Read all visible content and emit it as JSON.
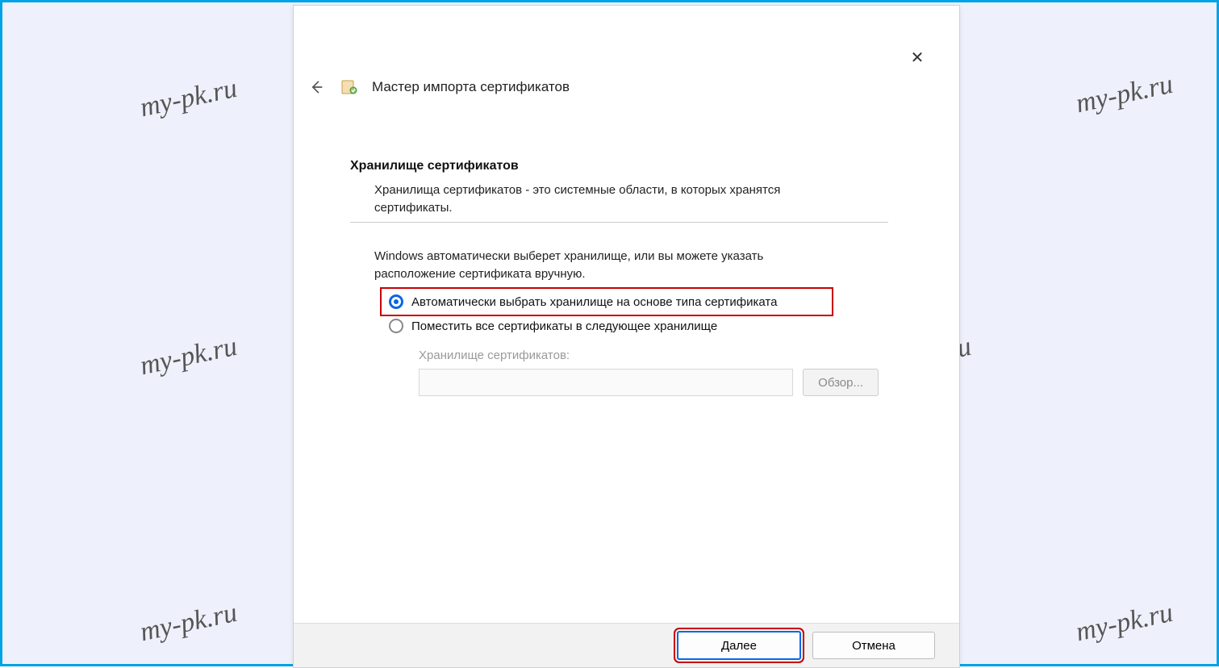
{
  "watermark": "my-pk.ru",
  "wizard": {
    "title": "Мастер импорта сертификатов",
    "close_glyph": "✕",
    "section_title": "Хранилище сертификатов",
    "section_desc": "Хранилища сертификатов - это системные области, в которых хранятся сертификаты.",
    "hint": "Windows автоматически выберет хранилище, или вы можете указать расположение сертификата вручную.",
    "option_auto": "Автоматически выбрать хранилище на основе типа сертификата",
    "option_manual": "Поместить все сертификаты в следующее хранилище",
    "store_label": "Хранилище сертификатов:",
    "browse": "Обзор...",
    "next": "Далее",
    "cancel": "Отмена"
  }
}
